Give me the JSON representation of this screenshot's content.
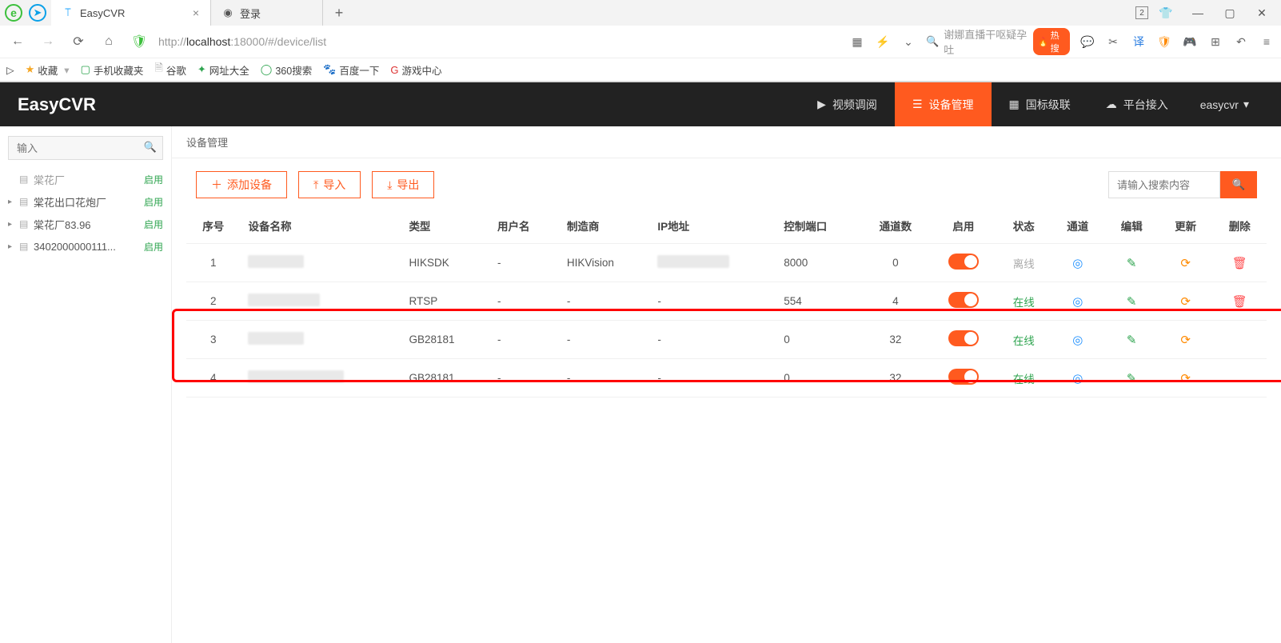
{
  "browser": {
    "tabs": [
      {
        "title": "EasyCVR",
        "active": true
      },
      {
        "title": "登录",
        "active": false
      }
    ],
    "url_host_prefix": "http://",
    "url_host": "localhost",
    "url_port_path": ":18000/#/device/list",
    "search_placeholder": "谢娜直播干呕疑孕吐",
    "hot_label": "热搜",
    "badge_number": "2"
  },
  "bookmarks": {
    "fav_label": "收藏",
    "items": [
      "手机收藏夹",
      "谷歌",
      "网址大全",
      "360搜索",
      "百度一下",
      "游戏中心"
    ]
  },
  "header": {
    "brand": "EasyCVR",
    "nav": [
      {
        "icon": "play",
        "label": "视频调阅"
      },
      {
        "icon": "list",
        "label": "设备管理",
        "active": true
      },
      {
        "icon": "grid",
        "label": "国标级联"
      },
      {
        "icon": "cloud",
        "label": "平台接入"
      }
    ],
    "user": "easycvr"
  },
  "sidebar": {
    "search_placeholder": "输入",
    "root": {
      "label": "棠花厂",
      "status": "启用"
    },
    "items": [
      {
        "label": "棠花出口花炮厂",
        "status": "启用"
      },
      {
        "label": "棠花厂83.96",
        "status": "启用"
      },
      {
        "label": "3402000000111...",
        "status": "启用"
      }
    ]
  },
  "page": {
    "title": "设备管理",
    "buttons": {
      "add": "添加设备",
      "import": "导入",
      "export": "导出"
    },
    "search_placeholder": "请输入搜索内容"
  },
  "table": {
    "columns": [
      "序号",
      "设备名称",
      "类型",
      "用户名",
      "制造商",
      "IP地址",
      "控制端口",
      "通道数",
      "启用",
      "状态",
      "通道",
      "编辑",
      "更新",
      "删除"
    ],
    "rows": [
      {
        "idx": "1",
        "type": "HIKSDK",
        "user": "-",
        "maker": "HIKVision",
        "ip": "(redacted)",
        "port": "8000",
        "ch": "0",
        "status": "离线",
        "status_cls": "offline",
        "del": true
      },
      {
        "idx": "2",
        "type": "RTSP",
        "user": "-",
        "maker": "-",
        "ip": "-",
        "port": "554",
        "ch": "4",
        "status": "在线",
        "status_cls": "online",
        "del": true
      },
      {
        "idx": "3",
        "type": "GB28181",
        "user": "-",
        "maker": "-",
        "ip": "-",
        "port": "0",
        "ch": "32",
        "status": "在线",
        "status_cls": "online",
        "del": false
      },
      {
        "idx": "4",
        "type": "GB28181",
        "user": "-",
        "maker": "-",
        "ip": "-",
        "port": "0",
        "ch": "32",
        "status": "在线",
        "status_cls": "online",
        "del": false
      }
    ]
  }
}
